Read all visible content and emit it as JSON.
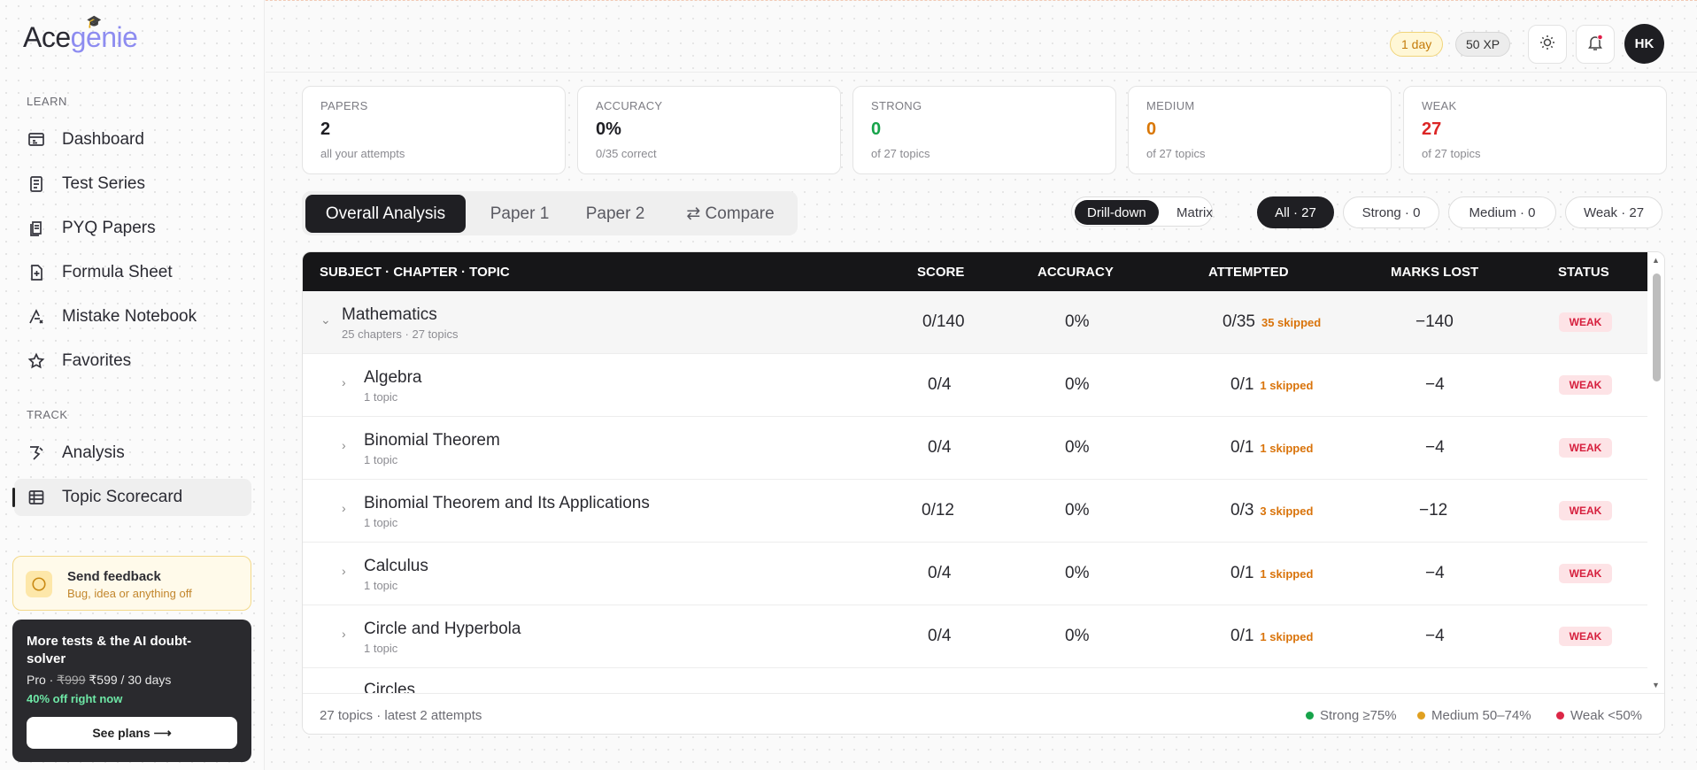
{
  "app": {
    "logo_prefix": "Ace",
    "logo_suffix": "genie"
  },
  "sidebar": {
    "learn_label": "LEARN",
    "track_label": "TRACK",
    "learn_items": [
      {
        "label": "Dashboard",
        "icon": "dashboard-icon"
      },
      {
        "label": "Test Series",
        "icon": "test-series-icon"
      },
      {
        "label": "PYQ Papers",
        "icon": "papers-icon"
      },
      {
        "label": "Formula Sheet",
        "icon": "formula-icon"
      },
      {
        "label": "Mistake Notebook",
        "icon": "mistake-icon"
      },
      {
        "label": "Favorites",
        "icon": "star-icon"
      }
    ],
    "track_items": [
      {
        "label": "Analysis",
        "icon": "analysis-icon"
      },
      {
        "label": "Topic Scorecard",
        "icon": "table-icon",
        "active": true
      }
    ],
    "feedback": {
      "title": "Send feedback",
      "subtitle": "Bug, idea or anything off"
    },
    "promo": {
      "heading": "More tests & the AI doubt-solver",
      "plan": "Pro · ",
      "old_price": "₹999",
      "price": " ₹599 / 30 days",
      "offer": "40% off right now",
      "button": "See plans ⟶"
    }
  },
  "topbar": {
    "streak": "1 day",
    "xp": "50 XP",
    "avatar": "HK"
  },
  "stats": [
    {
      "label": "PAPERS",
      "value": "2",
      "sub": "all your attempts",
      "color": "#1f1f24"
    },
    {
      "label": "ACCURACY",
      "value": "0%",
      "sub": "0/35 correct",
      "color": "#1f1f24"
    },
    {
      "label": "STRONG",
      "value": "0",
      "sub": "of 27 topics",
      "color": "#16a34a"
    },
    {
      "label": "MEDIUM",
      "value": "0",
      "sub": "of 27 topics",
      "color": "#d97706"
    },
    {
      "label": "WEAK",
      "value": "27",
      "sub": "of 27 topics",
      "color": "#dc2626"
    }
  ],
  "tabs": [
    "Overall Analysis",
    "Paper 1",
    "Paper 2",
    "⇄ Compare"
  ],
  "view_toggle": [
    "Drill-down",
    "Matrix"
  ],
  "filters": [
    "All · 27",
    "Strong · 0",
    "Medium · 0",
    "Weak · 27"
  ],
  "table": {
    "headers": [
      "SUBJECT · CHAPTER · TOPIC",
      "SCORE",
      "ACCURACY",
      "ATTEMPTED",
      "MARKS LOST",
      "STATUS"
    ],
    "group": {
      "name": "Mathematics",
      "sub": "25 chapters · 27 topics",
      "score": "0/140",
      "accuracy": "0%",
      "attempted": "0/35",
      "skipped": "35 skipped",
      "lost": "−140",
      "status": "WEAK"
    },
    "rows": [
      {
        "name": "Algebra",
        "sub": "1 topic",
        "score": "0/4",
        "accuracy": "0%",
        "attempted": "0/1",
        "skipped": "1 skipped",
        "lost": "−4",
        "status": "WEAK"
      },
      {
        "name": "Binomial Theorem",
        "sub": "1 topic",
        "score": "0/4",
        "accuracy": "0%",
        "attempted": "0/1",
        "skipped": "1 skipped",
        "lost": "−4",
        "status": "WEAK"
      },
      {
        "name": "Binomial Theorem and Its Applications",
        "sub": "1 topic",
        "score": "0/12",
        "accuracy": "0%",
        "attempted": "0/3",
        "skipped": "3 skipped",
        "lost": "−12",
        "status": "WEAK"
      },
      {
        "name": "Calculus",
        "sub": "1 topic",
        "score": "0/4",
        "accuracy": "0%",
        "attempted": "0/1",
        "skipped": "1 skipped",
        "lost": "−4",
        "status": "WEAK"
      },
      {
        "name": "Circle and Hyperbola",
        "sub": "1 topic",
        "score": "0/4",
        "accuracy": "0%",
        "attempted": "0/1",
        "skipped": "1 skipped",
        "lost": "−4",
        "status": "WEAK"
      },
      {
        "name": "Circles",
        "sub": "",
        "score": "",
        "accuracy": "",
        "attempted": "",
        "skipped": "",
        "lost": "",
        "status": ""
      }
    ],
    "footer_left": "27 topics · latest 2 attempts",
    "legend": [
      {
        "label": "Strong ≥75%",
        "color": "#16a34a"
      },
      {
        "label": "Medium 50–74%",
        "color": "#e0a020"
      },
      {
        "label": "Weak <50%",
        "color": "#dc2646"
      }
    ]
  }
}
